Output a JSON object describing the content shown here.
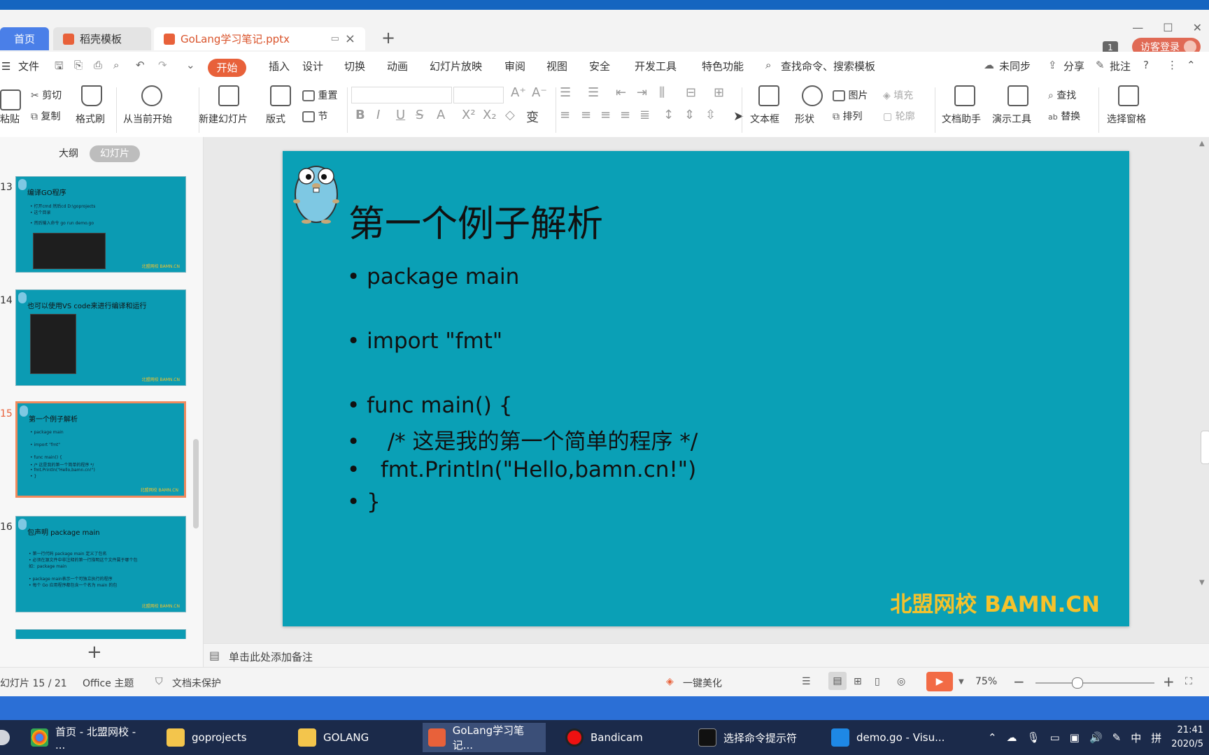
{
  "app": {
    "tabs": [
      {
        "label": "首页"
      },
      {
        "label": "稻壳模板"
      },
      {
        "label": "GoLang学习笔记.pptx"
      }
    ],
    "message_count": "1",
    "login_label": "访客登录"
  },
  "menu": {
    "file": "文件",
    "items": [
      "开始",
      "插入",
      "设计",
      "切换",
      "动画",
      "幻灯片放映",
      "审阅",
      "视图",
      "安全",
      "开发工具",
      "特色功能"
    ],
    "search": "查找命令、搜索模板",
    "sync": "未同步",
    "share": "分享",
    "comment": "批注"
  },
  "ribbon": {
    "paste": "粘贴",
    "cut": "剪切",
    "copy": "复制",
    "format_painter": "格式刷",
    "play_from_current": "从当前开始",
    "new_slide": "新建幻灯片",
    "layout": "版式",
    "reset": "重置",
    "section": "节",
    "textbox": "文本框",
    "shape": "形状",
    "picture": "图片",
    "arrange": "排列",
    "fill": "填充",
    "outline": "轮廓",
    "doc_assistant": "文档助手",
    "presentation_tools": "演示工具",
    "find": "查找",
    "replace": "替换",
    "selection_pane": "选择窗格"
  },
  "left_panel": {
    "tab_outline": "大纲",
    "tab_slides": "幻灯片",
    "thumbnails": [
      {
        "num": "13",
        "title": "编译GO程序",
        "footer": "北盟网校 BAMN.CN",
        "lines": [
          "• 打开cmd 然后cd D:\\goprojects",
          "• 这个目录",
          "• 然后输入命令 go run demo.go"
        ]
      },
      {
        "num": "14",
        "title": "也可以使用VS code来进行编译和运行",
        "footer": "北盟网校 BAMN.CN",
        "lines": []
      },
      {
        "num": "15",
        "title": "第一个例子解析",
        "footer": "北盟网校 BAMN.CN",
        "lines": [
          "• package main",
          "• import \"fmt\"",
          "• func main() {",
          "•   /* 这是我的第一个简单的程序 */",
          "•   fmt.Println(\"Hello,bamn.cn!\")",
          "• }"
        ]
      },
      {
        "num": "16",
        "title": "包声明 package main",
        "footer": "北盟网校 BAMN.CN",
        "lines": [
          "• 第一行代码 package main 定义了包名",
          "• 必须在源文件中非注释的第一行指明这个文件属于哪个包",
          "  如：package main",
          "• package main表示一个可独立执行的程序",
          "• 每个 Go 应用程序都包含一个名为 main 的包"
        ]
      }
    ]
  },
  "slide": {
    "title": "第一个例子解析",
    "bullets": [
      "• package main",
      "• import \"fmt\"",
      "• func main() {",
      "•    /* 这是我的第一个简单的程序 */",
      "•   fmt.Println(\"Hello,bamn.cn!\")",
      "• }"
    ],
    "footer": "北盟网校 BAMN.CN"
  },
  "notes_placeholder": "单击此处添加备注",
  "status": {
    "slide_counter": "幻灯片 15 / 21",
    "theme": "Office 主题",
    "protection": "文档未保护",
    "beautify": "一键美化",
    "zoom": "75%"
  },
  "taskbar": {
    "items": [
      {
        "label": "首页 - 北盟网校 - ..."
      },
      {
        "label": "goprojects"
      },
      {
        "label": "GOLANG"
      },
      {
        "label": "GoLang学习笔记..."
      },
      {
        "label": "Bandicam"
      },
      {
        "label": "选择命令提示符"
      },
      {
        "label": "demo.go - Visu..."
      }
    ],
    "ime_lang": "中",
    "ime_mode": "拼",
    "time": "21:41",
    "date": "2020/5"
  }
}
